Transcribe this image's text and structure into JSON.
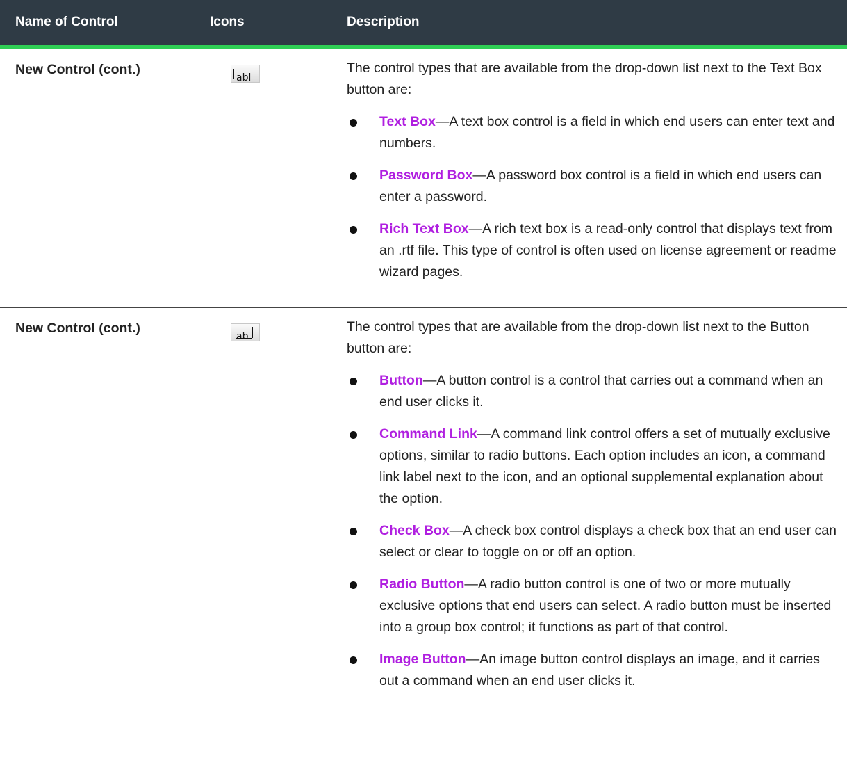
{
  "header": {
    "col_name": "Name of Control",
    "col_icons": "Icons",
    "col_desc": "Description"
  },
  "rows": [
    {
      "name": "New Control (cont.)",
      "icon": "text-box-icon",
      "icon_text": "abl",
      "intro": "The control types that are available from the drop-down list next to the Text Box button are:",
      "items": [
        {
          "term": "Text Box",
          "text": "—A text box control is a field in which end users can enter text and numbers."
        },
        {
          "term": "Password Box",
          "text": "—A password box control is a field in which end users can enter a password."
        },
        {
          "term": "Rich Text Box",
          "text": "—A rich text box is a read-only control that displays text from an .rtf file. This type of control is often used on license agreement or readme wizard pages."
        }
      ]
    },
    {
      "name": "New Control (cont.)",
      "icon": "push-button-icon",
      "icon_text": "ab",
      "intro": "The control types that are available from the drop-down list next to the Button button are:",
      "items": [
        {
          "term": "Button",
          "text": "—A button control is a control that carries out a command when an end user clicks it."
        },
        {
          "term": "Command Link",
          "text": "—A command link control offers a set of mutually exclusive options, similar to radio buttons. Each option includes an icon, a command link label next to the icon, and an optional supplemental explanation about the option."
        },
        {
          "term": "Check Box",
          "text": "—A check box control displays a check box that an end user can select or clear to toggle on or off an option."
        },
        {
          "term": "Radio Button",
          "text": "—A radio button control is one of two or more mutually exclusive options that end users can select. A radio button must be inserted into a group box control; it functions as part of that control."
        },
        {
          "term": "Image Button",
          "text": "—An image button control displays an image, and it carries out a command when an end user clicks it."
        }
      ]
    }
  ],
  "colors": {
    "header_bg": "#2f3b45",
    "header_rule": "#2fcf55",
    "link": "#b01fe0"
  }
}
